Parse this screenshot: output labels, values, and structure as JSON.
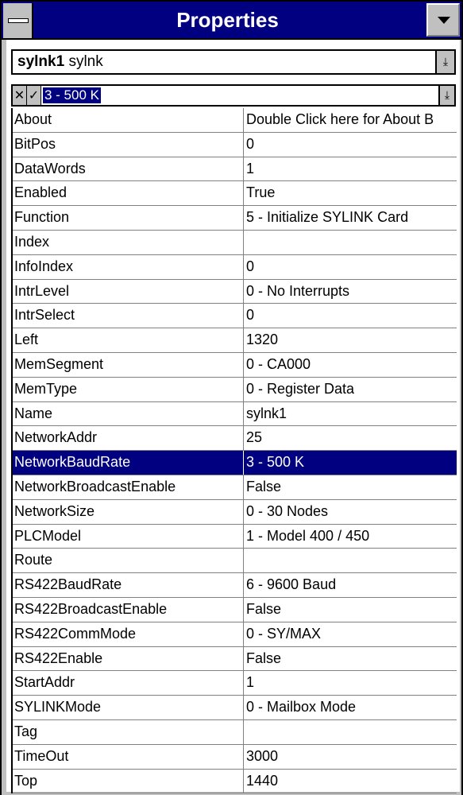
{
  "window": {
    "title": "Properties"
  },
  "object_selector": {
    "name": "sylnk1",
    "type": "sylnk"
  },
  "edit_box": {
    "cancel_glyph": "✕",
    "accept_glyph": "✓",
    "value": "3 - 500 K"
  },
  "properties": [
    {
      "name": "About",
      "value": "Double Click here for About B"
    },
    {
      "name": "BitPos",
      "value": "0"
    },
    {
      "name": "DataWords",
      "value": "1"
    },
    {
      "name": "Enabled",
      "value": "True"
    },
    {
      "name": "Function",
      "value": "5 - Initialize SYLINK Card"
    },
    {
      "name": "Index",
      "value": ""
    },
    {
      "name": "InfoIndex",
      "value": "0"
    },
    {
      "name": "IntrLevel",
      "value": "0 - No Interrupts"
    },
    {
      "name": "IntrSelect",
      "value": "0"
    },
    {
      "name": "Left",
      "value": "1320"
    },
    {
      "name": "MemSegment",
      "value": "0 - CA000"
    },
    {
      "name": "MemType",
      "value": "0 - Register Data"
    },
    {
      "name": "Name",
      "value": "sylnk1"
    },
    {
      "name": "NetworkAddr",
      "value": "25"
    },
    {
      "name": "NetworkBaudRate",
      "value": "3 - 500 K",
      "selected": true
    },
    {
      "name": "NetworkBroadcastEnable",
      "value": "False"
    },
    {
      "name": "NetworkSize",
      "value": "0 - 30 Nodes"
    },
    {
      "name": "PLCModel",
      "value": "1 - Model 400 / 450"
    },
    {
      "name": "Route",
      "value": ""
    },
    {
      "name": "RS422BaudRate",
      "value": "6 - 9600 Baud"
    },
    {
      "name": "RS422BroadcastEnable",
      "value": "False"
    },
    {
      "name": "RS422CommMode",
      "value": "0 - SY/MAX"
    },
    {
      "name": "RS422Enable",
      "value": "False"
    },
    {
      "name": "StartAddr",
      "value": "1"
    },
    {
      "name": "SYLINKMode",
      "value": "0 - Mailbox Mode"
    },
    {
      "name": "Tag",
      "value": ""
    },
    {
      "name": "TimeOut",
      "value": "3000"
    },
    {
      "name": "Top",
      "value": "1440"
    }
  ],
  "colors": {
    "title_bar": "#000080",
    "selection": "#000080",
    "chrome": "#c0c0c0"
  },
  "icons": {
    "system_menu": "system-menu-icon",
    "maximize": "maximize-arrow-icon",
    "dropdown": "dropdown-arrow-icon"
  }
}
